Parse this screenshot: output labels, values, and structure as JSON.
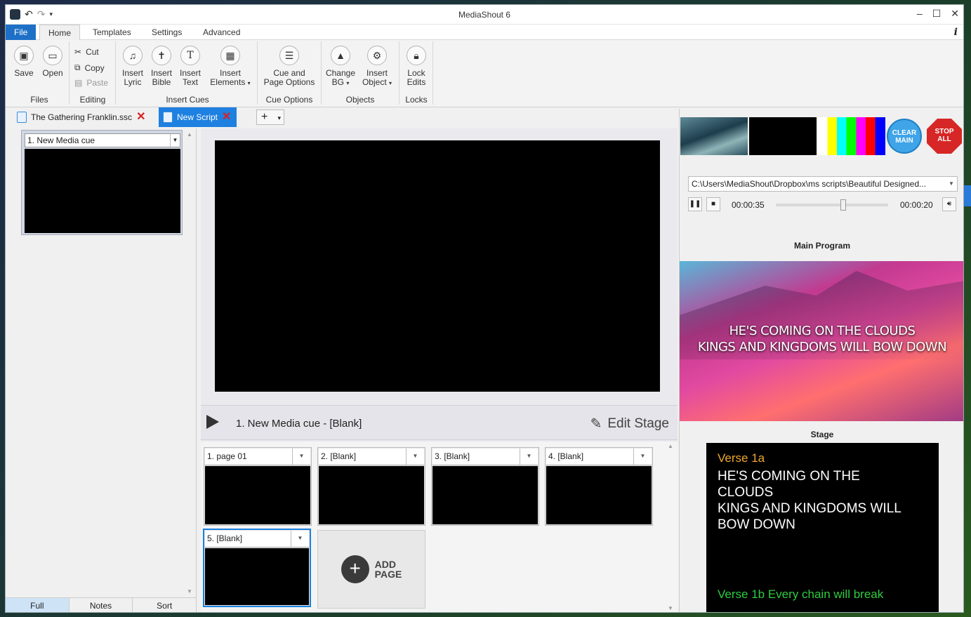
{
  "window": {
    "title": "MediaShout 6"
  },
  "menu": {
    "file": "File",
    "home": "Home",
    "templates": "Templates",
    "settings": "Settings",
    "advanced": "Advanced"
  },
  "ribbon": {
    "save": "Save",
    "open": "Open",
    "files_group": "Files",
    "cut": "Cut",
    "copy": "Copy",
    "paste": "Paste",
    "editing_group": "Editing",
    "insert_lyric_1": "Insert",
    "insert_lyric_2": "Lyric",
    "insert_bible_1": "Insert",
    "insert_bible_2": "Bible",
    "insert_text_1": "Insert",
    "insert_text_2": "Text",
    "insert_elements_1": "Insert",
    "insert_elements_2": "Elements",
    "insert_cues_group": "Insert Cues",
    "cue_page_1": "Cue and",
    "cue_page_2": "Page Options",
    "cue_options_group": "Cue Options",
    "change_bg_1": "Change",
    "change_bg_2": "BG",
    "insert_object_1": "Insert",
    "insert_object_2": "Object",
    "objects_group": "Objects",
    "lock_1": "Lock",
    "lock_2": "Edits",
    "locks_group": "Locks"
  },
  "tabs": [
    {
      "label": "The Gathering Franklin.ssc"
    },
    {
      "label": "New Script"
    }
  ],
  "left": {
    "cue_label": "1. New Media cue",
    "bottom_tabs": [
      "Full",
      "Notes",
      "Sort"
    ]
  },
  "center": {
    "cue_title": "1. New Media cue  -  [Blank]",
    "edit_stage": "Edit Stage",
    "pages": [
      "1. page 01",
      "2. [Blank]",
      "3. [Blank]",
      "4. [Blank]",
      "5. [Blank]"
    ],
    "add_page_1": "ADD",
    "add_page_2": "PAGE"
  },
  "right": {
    "clear_main_1": "CLEAR",
    "clear_main_2": "MAIN",
    "stop_all_1": "STOP",
    "stop_all_2": "ALL",
    "media_path": "C:\\Users\\MediaShout\\Dropbox\\ms scripts\\Beautiful Designed...",
    "elapsed": "00:00:35",
    "remaining": "00:00:20",
    "playback_position": 0.6,
    "main_program_title": "Main Program",
    "main_lyric_1": "HE'S COMING ON THE CLOUDS",
    "main_lyric_2": "KINGS AND KINGDOMS WILL BOW DOWN",
    "stage_title": "Stage",
    "stage_verse_label": "Verse 1a",
    "stage_line_1": "HE'S COMING ON THE",
    "stage_line_2": "CLOUDS",
    "stage_line_3": "KINGS AND KINGDOMS WILL",
    "stage_line_4": "BOW DOWN",
    "stage_next": "Verse 1b Every chain will break"
  },
  "colors": {
    "accent": "#1e80e0",
    "stop": "#d72626",
    "clear": "#3fa4e8",
    "verse_label": "#f0a830",
    "next_verse": "#2ecc40"
  }
}
